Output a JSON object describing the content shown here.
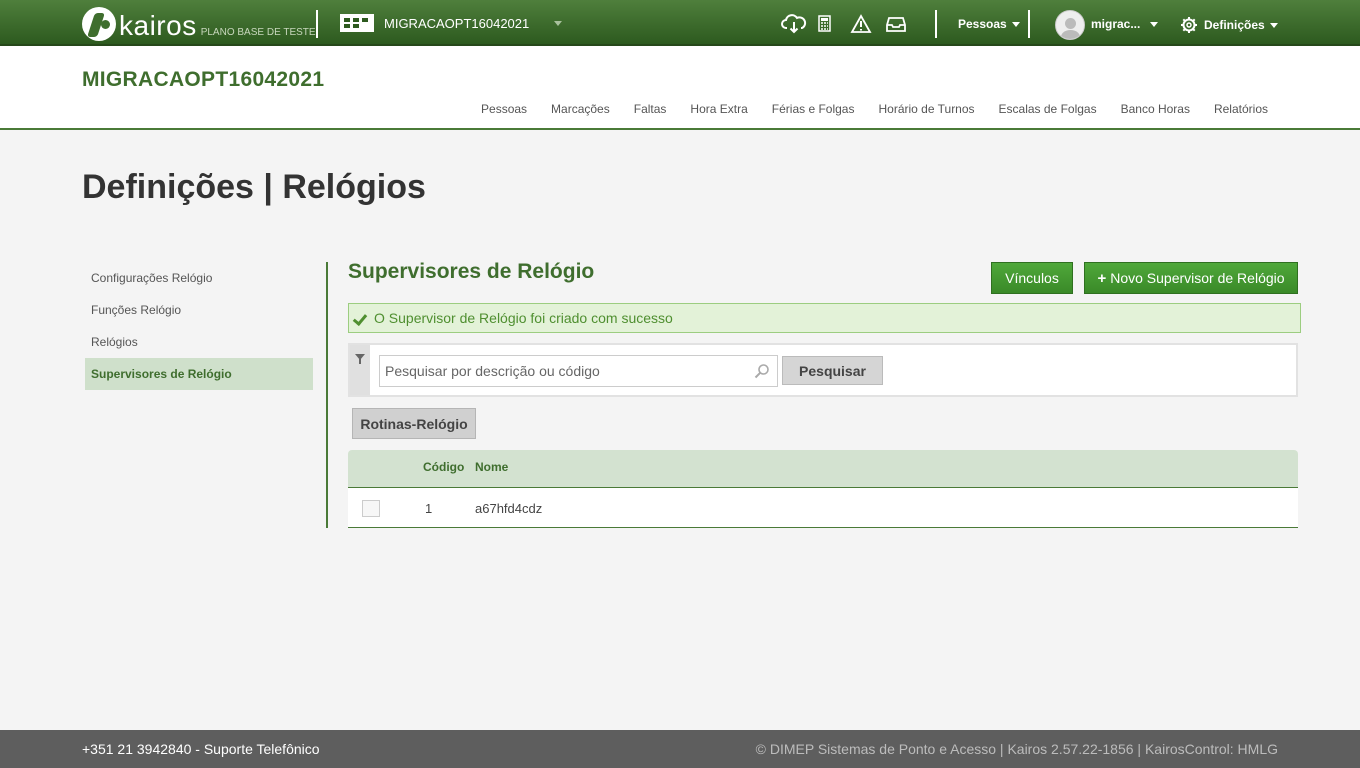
{
  "topbar": {
    "logo_text": "kairos",
    "logo_subtitle": "PLANO BASE DE TESTE",
    "company_name": "MIGRACAOPT16042021",
    "icons": [
      "cloud-download-icon",
      "calculator-icon",
      "warning-icon",
      "inbox-icon"
    ],
    "pessoas_label": "Pessoas",
    "user_label": "migrac...",
    "definicoes_label": "Definições"
  },
  "header": {
    "company_title": "MIGRACAOPT16042021",
    "nav": [
      "Pessoas",
      "Marcações",
      "Faltas",
      "Hora Extra",
      "Férias e Folgas",
      "Horário de Turnos",
      "Escalas de Folgas",
      "Banco Horas",
      "Relatórios"
    ]
  },
  "page": {
    "title": "Definições | Relógios"
  },
  "sidebar": {
    "items": [
      {
        "label": "Configurações Relógio",
        "active": false
      },
      {
        "label": "Funções Relógio",
        "active": false
      },
      {
        "label": "Relógios",
        "active": false
      },
      {
        "label": "Supervisores de Relógio",
        "active": true
      }
    ]
  },
  "content": {
    "section_title": "Supervisores de Relógio",
    "vinculos_label": "Vínculos",
    "novo_label": "Novo Supervisor de Relógio",
    "success_message": "O Supervisor de Relógio foi criado com sucesso",
    "search_placeholder": "Pesquisar por descrição ou código",
    "search_button": "Pesquisar",
    "rotinas_label": "Rotinas-Relógio",
    "table": {
      "columns": [
        "Código",
        "Nome"
      ],
      "rows": [
        {
          "codigo": "1",
          "nome": "a67hfd4cdz"
        }
      ]
    }
  },
  "footer": {
    "support": "+351 21 3942840 - Suporte Telefônico",
    "copyright": "© DIMEP Sistemas de Ponto e Acesso | Kairos 2.57.22-1856 | KairosControl: HMLG"
  },
  "colors": {
    "brand_green": "#3f6e2e",
    "button_green": "#3a8a28",
    "success_bg": "#e3f2d8",
    "footer_bg": "#5e5e5e"
  }
}
